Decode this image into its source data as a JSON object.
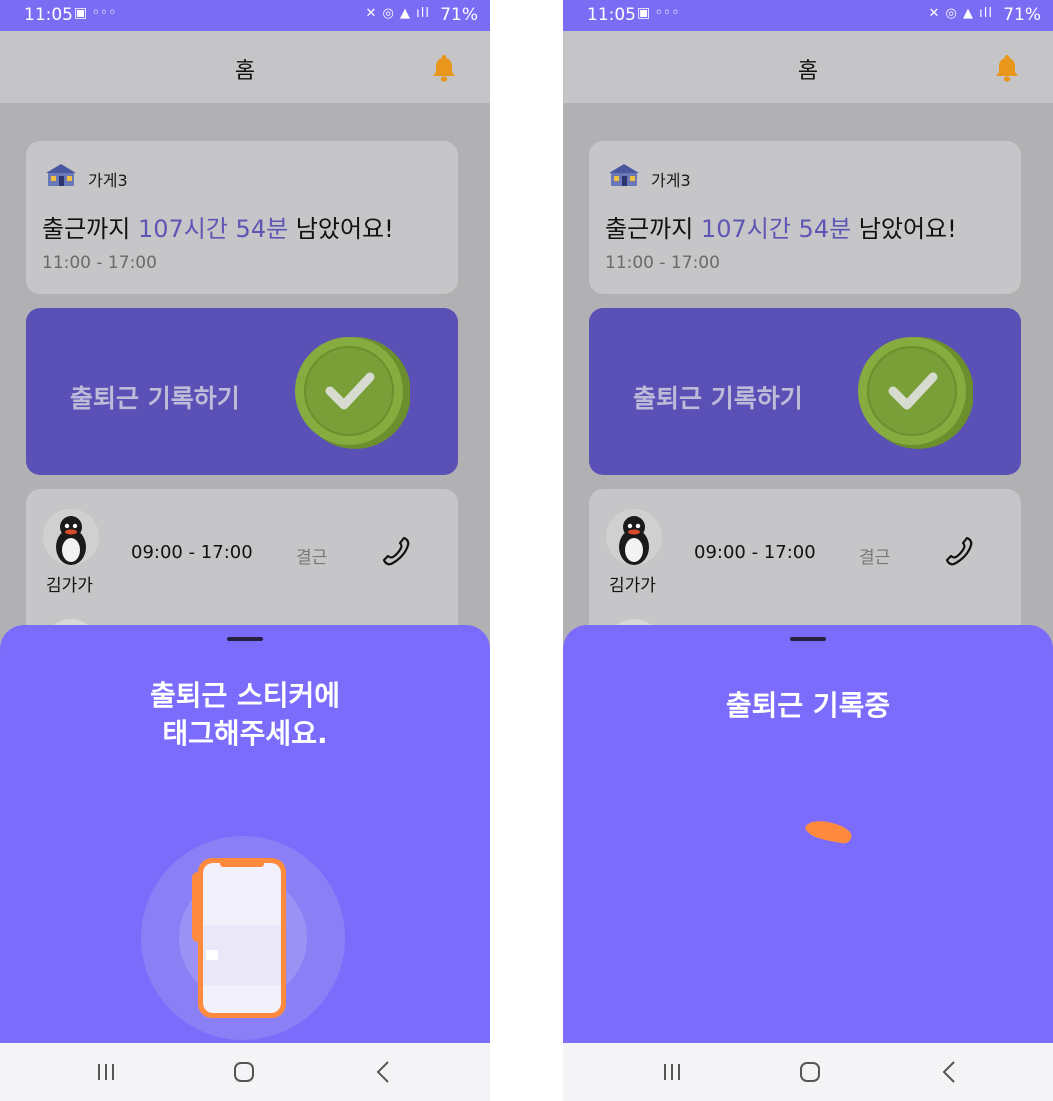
{
  "left": {
    "status": {
      "time": "11:05",
      "battery": "71%"
    },
    "appbar": {
      "title": "홈"
    },
    "store": {
      "name": "가게3",
      "countdown_prefix": "출근까지 ",
      "countdown_highlight": "107시간 54분",
      "countdown_suffix": " 남았어요!",
      "hours": "11:00 - 17:00"
    },
    "record": {
      "label": "출퇴근 기록하기"
    },
    "worker": {
      "name": "김가가",
      "shift": "09:00 - 17:00",
      "status": "결근"
    },
    "sheet": {
      "title": "출퇴근 스티커에\n태그해주세요."
    }
  },
  "right": {
    "status": {
      "time": "11:05",
      "battery": "71%"
    },
    "appbar": {
      "title": "홈"
    },
    "store": {
      "name": "가게3",
      "countdown_prefix": "출근까지 ",
      "countdown_highlight": "107시간 54분",
      "countdown_suffix": " 남았어요!",
      "hours": "11:00 - 17:00"
    },
    "record": {
      "label": "출퇴근 기록하기"
    },
    "worker": {
      "name": "김가가",
      "shift": "09:00 - 17:00",
      "status": "결근"
    },
    "sheet": {
      "title": "출퇴근 기록중"
    }
  },
  "colors": {
    "accent": "#7b6cfc",
    "record_card": "#5a50b6",
    "highlight": "#5e55b5",
    "bell": "#e8961c",
    "coin": "#7fa43a",
    "phone_frame": "#ff8a3d"
  },
  "icons": [
    "bell-icon",
    "store-icon",
    "check-coin-icon",
    "phone-call-icon",
    "recents-icon",
    "home-icon",
    "back-icon"
  ]
}
